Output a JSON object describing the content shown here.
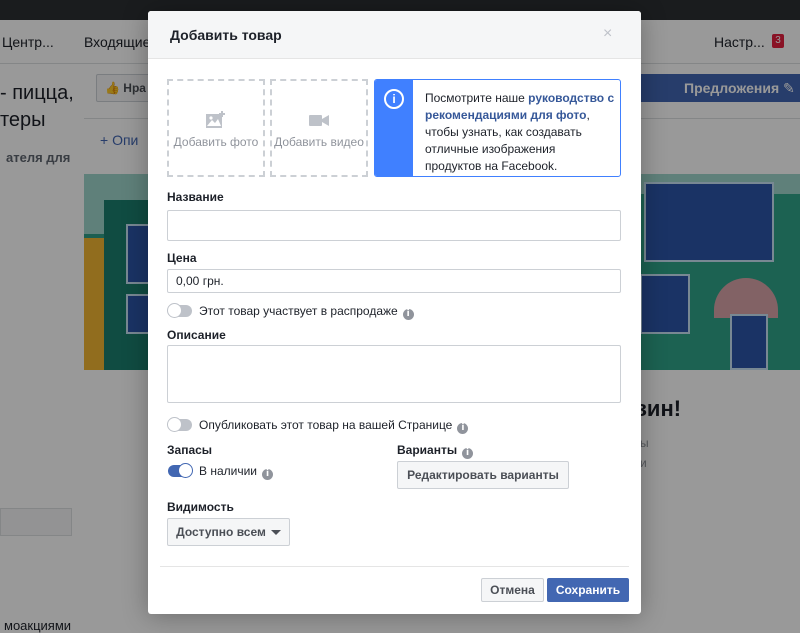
{
  "background": {
    "nav": {
      "center": "Центр...",
      "inbox": "Входящие",
      "settings": "Настр...",
      "badge": "3"
    },
    "left_title": "- пицца, теры",
    "left_subtitle": "ателя для",
    "left_bottom": "моакциями",
    "like_button": "Нра",
    "offers": "Предложения",
    "add_description": "+ Опи",
    "cover_heading": "зин!",
    "ghost_line1": "ы",
    "ghost_line2": "и"
  },
  "dialog": {
    "title": "Добавить товар",
    "close_glyph": "×",
    "add_photo": "Добавить фото",
    "add_video": "Добавить видео",
    "info": {
      "text_before": "Посмотрите наше ",
      "link": "руководство с рекомендациями для фото",
      "text_after": ", чтобы узнать, как создавать отличные изображения продуктов на Facebook.",
      "icon_glyph": "i"
    },
    "name_label": "Название",
    "name_value": "",
    "price_label": "Цена",
    "price_value": "0,00 грн.",
    "sale_toggle_label": "Этот товар участвует в распродаже",
    "description_label": "Описание",
    "description_value": "",
    "publish_toggle_label": "Опубликовать этот товар на вашей Странице",
    "stock_label": "Запасы",
    "in_stock_label": "В наличии",
    "variants_label": "Варианты",
    "edit_variants_button": "Редактировать варианты",
    "visibility_label": "Видимость",
    "visibility_value": "Доступно всем",
    "cancel_button": "Отмена",
    "save_button": "Сохранить",
    "info_dot_glyph": "i"
  },
  "colors": {
    "accent": "#4267b2",
    "info_border": "#4080ff",
    "badge": "#e41e3f"
  }
}
